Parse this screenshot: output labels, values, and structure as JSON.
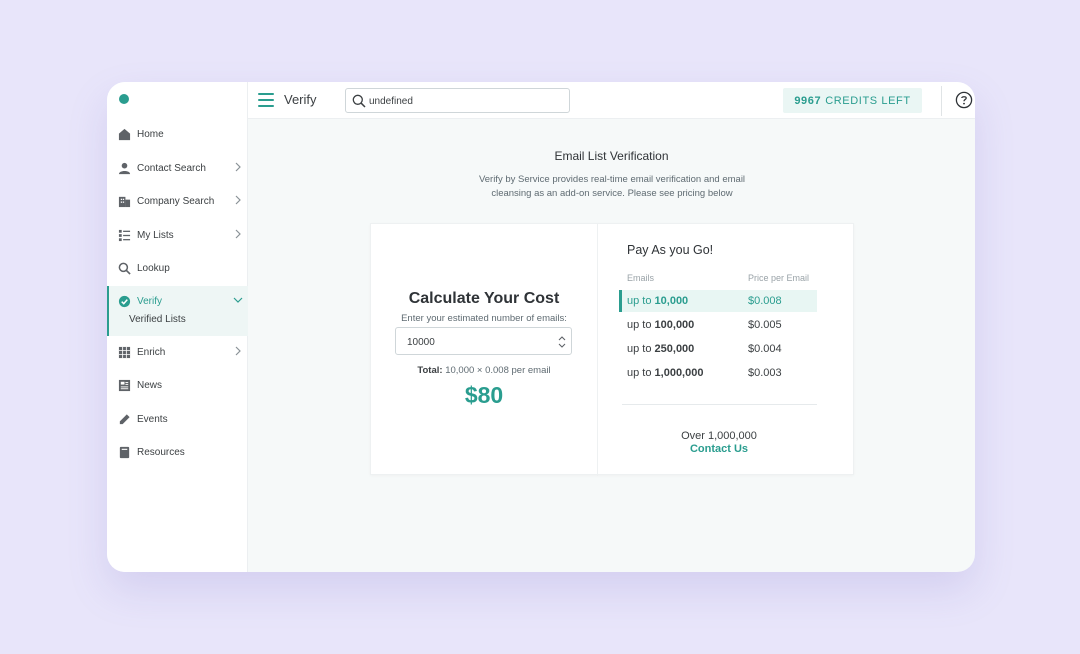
{
  "colors": {
    "accent": "#2a9d8f",
    "background": "#e8e5fa"
  },
  "sidebar": {
    "items": [
      {
        "label": "Home",
        "icon": "home-icon"
      },
      {
        "label": "Contact Search",
        "icon": "person-icon",
        "has_chevron": true
      },
      {
        "label": "Company Search",
        "icon": "building-icon",
        "has_chevron": true
      },
      {
        "label": "My Lists",
        "icon": "list-icon",
        "has_chevron": true
      },
      {
        "label": "Lookup",
        "icon": "search-icon"
      },
      {
        "label": "Verify",
        "icon": "check-circle-icon",
        "active": true,
        "expanded": true
      },
      {
        "label": "Enrich",
        "icon": "grid-icon",
        "has_chevron": true
      },
      {
        "label": "News",
        "icon": "newspaper-icon"
      },
      {
        "label": "Events",
        "icon": "pen-icon"
      },
      {
        "label": "Resources",
        "icon": "book-icon"
      }
    ],
    "sub_items": [
      {
        "label": "Verified Lists"
      }
    ]
  },
  "header": {
    "title": "Verify",
    "search": {
      "value": "undefined",
      "placeholder": ""
    },
    "credits": {
      "count": "9967",
      "label": "CREDITS LEFT"
    }
  },
  "main": {
    "title": "Email List Verification",
    "description": "Verify by Service provides real-time email verification and email cleansing as an add-on service. Please see pricing below"
  },
  "calculator": {
    "title": "Calculate Your Cost",
    "subtitle": "Enter your estimated number of emails:",
    "quantity": "10000",
    "total_label": "Total:",
    "total_formula": "10,000 × 0.008 per email",
    "total_price": "$80"
  },
  "pricing": {
    "title": "Pay As you Go!",
    "col_emails": "Emails",
    "col_price": "Price per Email",
    "tiers": [
      {
        "prefix": "up to",
        "range": "10,000",
        "price": "$0.008",
        "active": true
      },
      {
        "prefix": "up to",
        "range": "100,000",
        "price": "$0.005"
      },
      {
        "prefix": "up to",
        "range": "250,000",
        "price": "$0.004"
      },
      {
        "prefix": "up to",
        "range": "1,000,000",
        "price": "$0.003"
      }
    ],
    "over_text": "Over 1,000,000",
    "contact_label": "Contact Us"
  }
}
